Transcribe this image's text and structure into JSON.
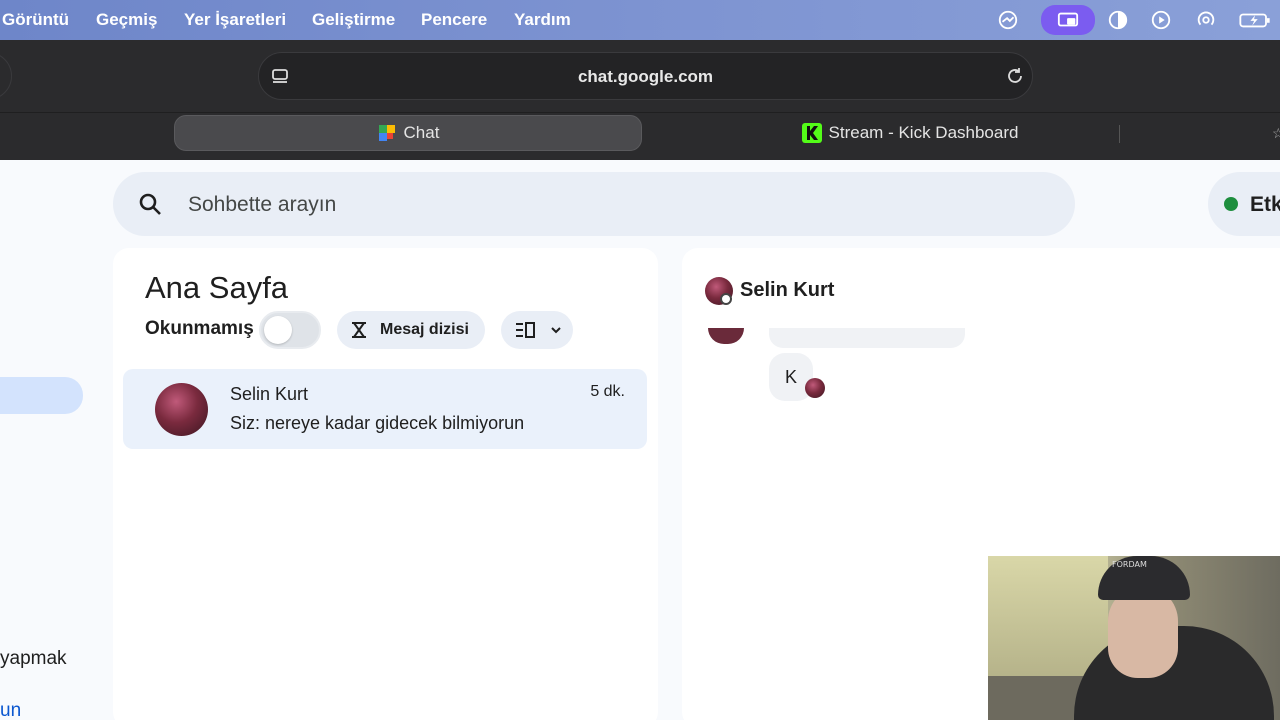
{
  "menubar": {
    "items": [
      "Görüntü",
      "Geçmiş",
      "Yer İşaretleri",
      "Geliştirme",
      "Pencere",
      "Yardım"
    ],
    "icons": [
      "shared-screen-icon",
      "screen-record-icon",
      "contrast-icon",
      "play-icon",
      "airdrop-icon",
      "battery-icon"
    ]
  },
  "browser": {
    "url": "chat.google.com",
    "tabs": [
      {
        "label": "Chat",
        "icon": "google-chat-icon"
      },
      {
        "label": "Stream - Kick Dashboard",
        "icon": "kick-icon"
      }
    ]
  },
  "search": {
    "placeholder": "Sohbette arayın"
  },
  "status": {
    "label": "Etk",
    "color": "#1e8e3e"
  },
  "leftnav": {
    "partial_1": "yapmak",
    "partial_2": "un"
  },
  "list": {
    "title": "Ana Sayfa",
    "unread_label": "Okunmamış",
    "unread_toggle_on": false,
    "thread_button": "Mesaj dizisi",
    "conversations": [
      {
        "name": "Selin Kurt",
        "snippet": "Siz: nereye kadar gidecek bilmiyorun",
        "time": "5 dk."
      }
    ]
  },
  "chat": {
    "contact_name": "Selin Kurt",
    "last_message": "K"
  },
  "webcam": {
    "cap_text": "FORDAM"
  },
  "colors": {
    "accent": "#0b57d0",
    "menubar": "#7b92d2",
    "active_chip": "#d3e3fd"
  }
}
